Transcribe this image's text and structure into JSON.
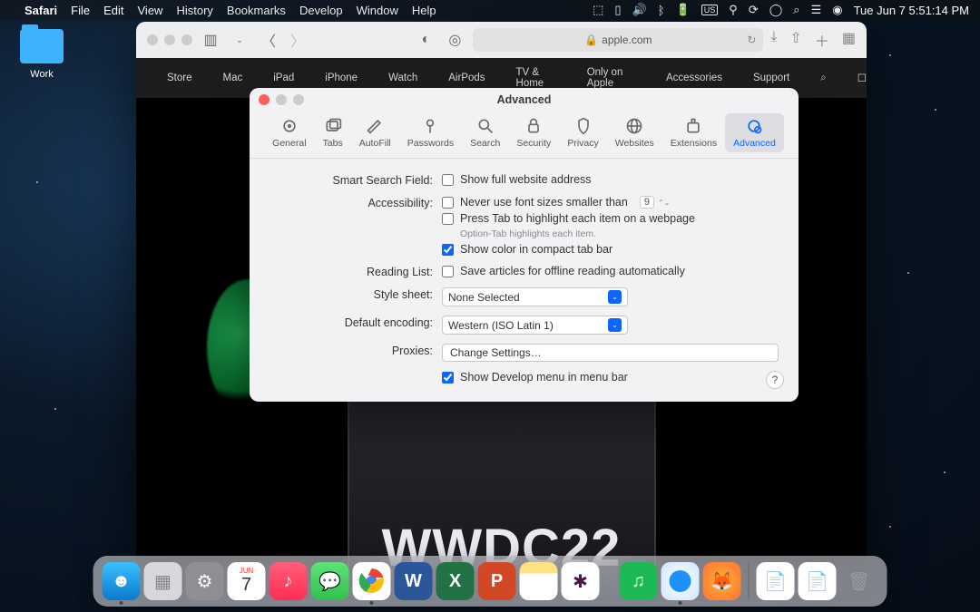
{
  "menubar": {
    "app": "Safari",
    "items": [
      "File",
      "Edit",
      "View",
      "History",
      "Bookmarks",
      "Develop",
      "Window",
      "Help"
    ],
    "clock": "Tue Jun 7  5:51:14 PM"
  },
  "desktop": {
    "folder_label": "Work"
  },
  "safari": {
    "url": "apple.com",
    "nav": [
      "Store",
      "Mac",
      "iPad",
      "iPhone",
      "Watch",
      "AirPods",
      "TV & Home",
      "Only on Apple",
      "Accessories",
      "Support"
    ],
    "hero_text": "WWDC22"
  },
  "prefs": {
    "title": "Advanced",
    "tabs": [
      "General",
      "Tabs",
      "AutoFill",
      "Passwords",
      "Search",
      "Security",
      "Privacy",
      "Websites",
      "Extensions",
      "Advanced"
    ],
    "active_tab": "Advanced",
    "smart_search_label": "Smart Search Field:",
    "smart_search_opt": "Show full website address",
    "accessibility_label": "Accessibility:",
    "acc_opt1": "Never use font sizes smaller than",
    "acc_fontsize": "9",
    "acc_opt2": "Press Tab to highlight each item on a webpage",
    "acc_hint": "Option-Tab highlights each item.",
    "acc_opt3": "Show color in compact tab bar",
    "reading_label": "Reading List:",
    "reading_opt": "Save articles for offline reading automatically",
    "stylesheet_label": "Style sheet:",
    "stylesheet_value": "None Selected",
    "encoding_label": "Default encoding:",
    "encoding_value": "Western (ISO Latin 1)",
    "proxies_label": "Proxies:",
    "proxies_btn": "Change Settings…",
    "develop_opt": "Show Develop menu in menu bar",
    "help": "?"
  },
  "dock": {
    "apps": [
      "finder",
      "launchpad",
      "settings",
      "calendar",
      "music",
      "messages",
      "chrome",
      "word",
      "excel",
      "powerpoint",
      "notes",
      "slack",
      "spotify",
      "safari",
      "firefox"
    ],
    "right": [
      "textedit-doc",
      "pages-doc",
      "trash"
    ],
    "calendar_day": "7",
    "calendar_month": "JUN"
  }
}
